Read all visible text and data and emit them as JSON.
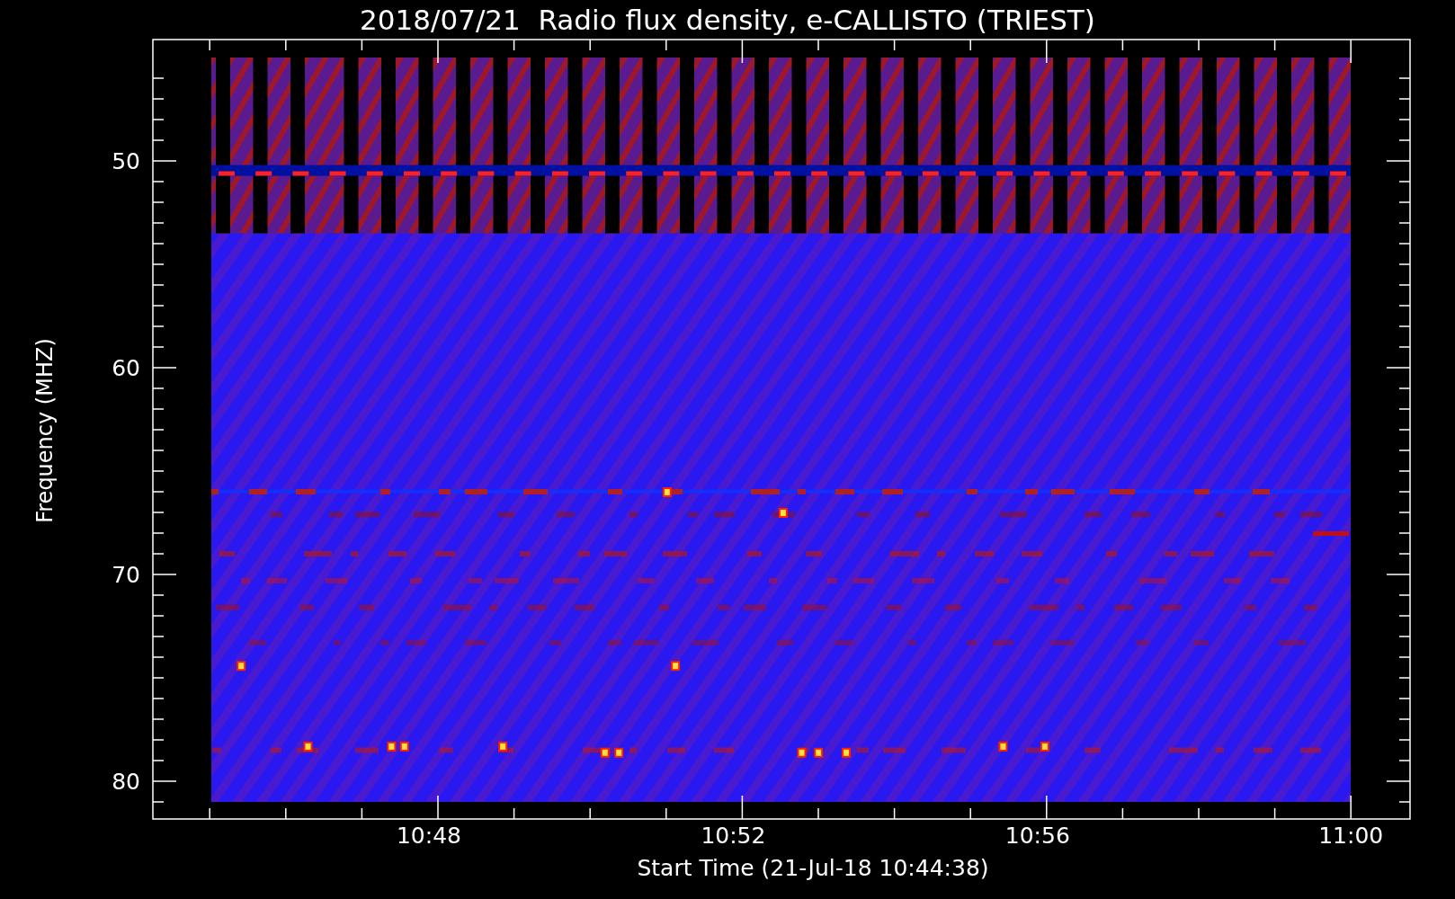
{
  "title": "2018/07/21  Radio flux density, e-CALLISTO (TRIEST)",
  "y_axis": {
    "label": "Frequency (MHZ)",
    "ticks": [
      "50",
      "60",
      "70",
      "80"
    ]
  },
  "x_axis": {
    "label": "Start Time (21-Jul-18 10:44:38)",
    "ticks": [
      "10:48",
      "10:52",
      "10:56",
      "11:00"
    ]
  }
}
